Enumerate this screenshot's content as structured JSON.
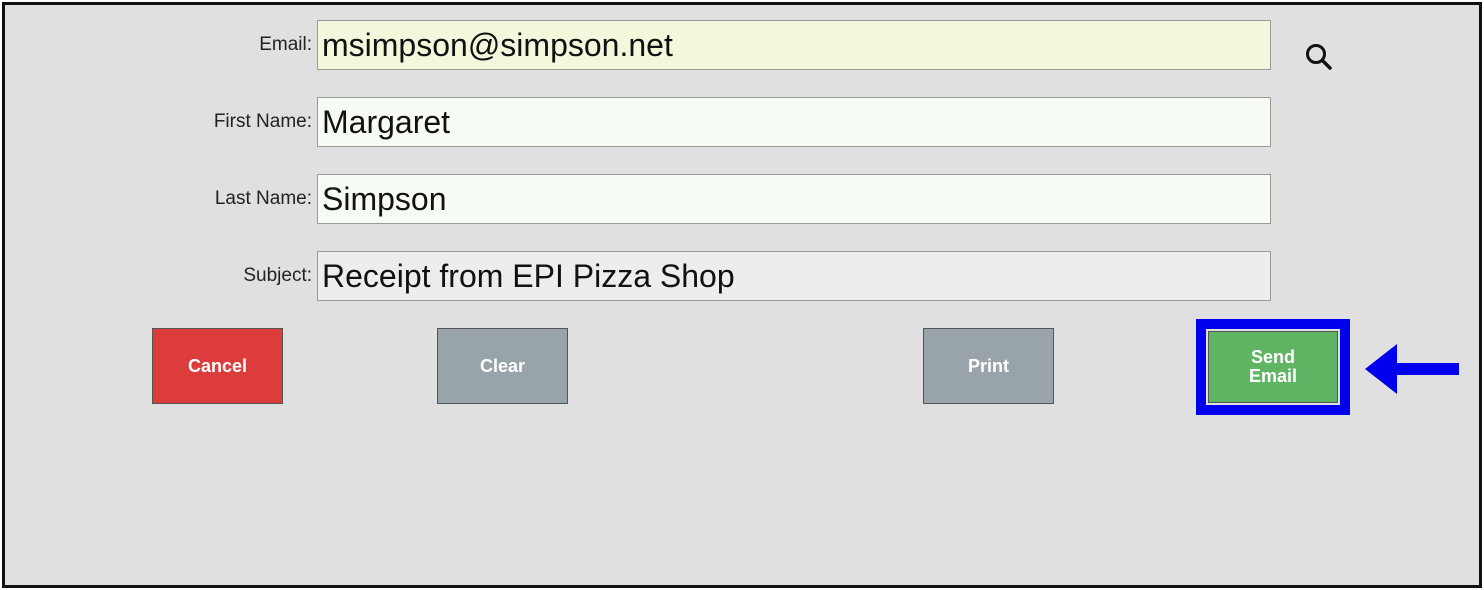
{
  "form": {
    "email": {
      "label": "Email:",
      "value": "msimpson@simpson.net",
      "bg": "#f5f7dc"
    },
    "first_name": {
      "label": "First Name:",
      "value": "Margaret",
      "bg": "#f6fbf3"
    },
    "last_name": {
      "label": "Last Name:",
      "value": "Simpson",
      "bg": "#f6fbf3"
    },
    "subject": {
      "label": "Subject:",
      "value": "Receipt from EPI Pizza Shop",
      "bg": "#ebeeea"
    }
  },
  "buttons": {
    "cancel": {
      "label": "Cancel",
      "color": "#dc3c3c"
    },
    "clear": {
      "label": "Clear",
      "color": "#98a3aa"
    },
    "print": {
      "label": "Print",
      "color": "#98a3aa"
    },
    "send_email": {
      "label": "Send Email",
      "color": "#5fb564"
    }
  },
  "icons": {
    "search": "search-icon",
    "arrow": "arrow-left-icon"
  },
  "annotation": {
    "highlight_color": "#0000ee"
  }
}
